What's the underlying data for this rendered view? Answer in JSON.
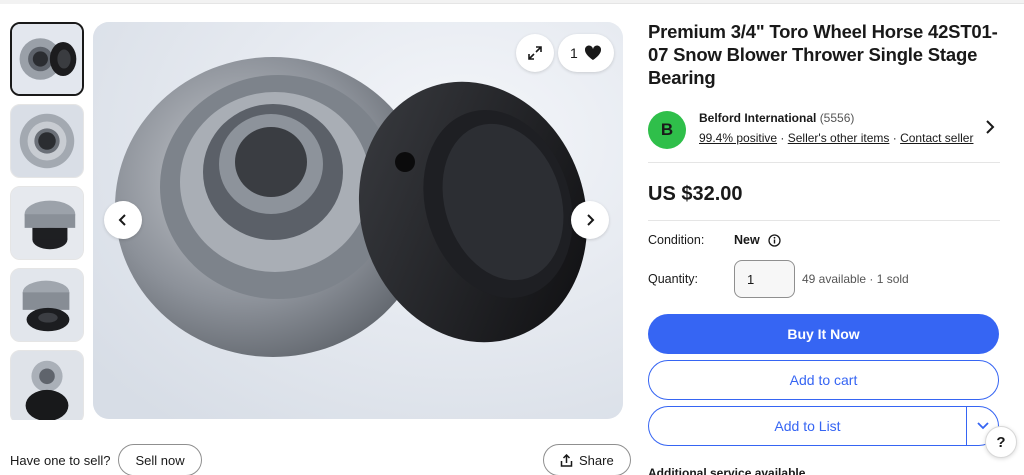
{
  "listing": {
    "title": "Premium 3/4\" Toro Wheel Horse 42ST01-07 Snow Blower Thrower Single Stage Bearing",
    "price": "US $32.00"
  },
  "gallery": {
    "watch_count": "1",
    "thumbnails": [
      "thumb-1",
      "thumb-2",
      "thumb-3",
      "thumb-4",
      "thumb-5"
    ]
  },
  "seller": {
    "avatar_letter": "B",
    "name": "Belford International",
    "feedback_count": "(5556)",
    "positive": "99.4% positive",
    "other_items": "Seller's other items",
    "contact": "Contact seller",
    "avatar_color": "#2fbf4a"
  },
  "details": {
    "condition_label": "Condition:",
    "condition_value": "New",
    "quantity_label": "Quantity:",
    "quantity_value": "1",
    "availability": "49 available · 1 sold"
  },
  "actions": {
    "buy_now": "Buy It Now",
    "add_to_cart": "Add to cart",
    "add_to_list": "Add to List",
    "additional": "Additional service available"
  },
  "sell_promo": {
    "prompt": "Have one to sell?",
    "sell_now": "Sell now"
  },
  "share": {
    "label": "Share"
  },
  "help": {
    "label": "?"
  },
  "colors": {
    "accent": "#3665f3",
    "text": "#191919"
  }
}
